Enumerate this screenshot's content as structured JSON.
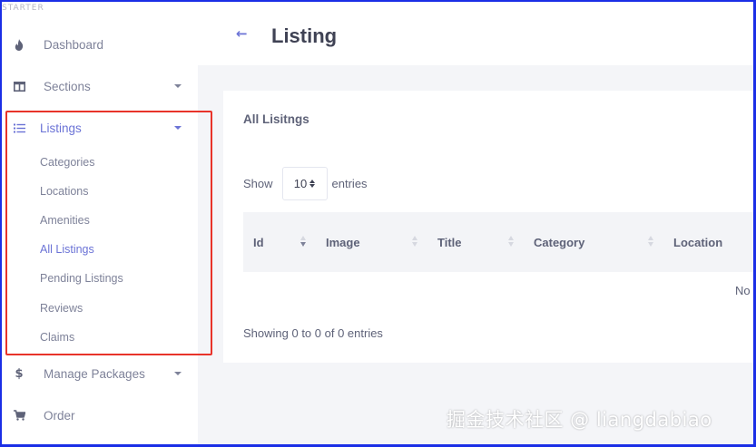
{
  "brand": "STARTER",
  "header": {
    "title": "Listing"
  },
  "sidebar": {
    "items": [
      {
        "label": "Dashboard",
        "icon": "fire-icon"
      },
      {
        "label": "Sections",
        "icon": "columns-icon"
      },
      {
        "label": "Listings",
        "icon": "list-icon"
      },
      {
        "label": "Manage Packages",
        "icon": "dollar-icon"
      },
      {
        "label": "Order",
        "icon": "cart-icon"
      }
    ],
    "submenu": [
      "Categories",
      "Locations",
      "Amenities",
      "All Listings",
      "Pending Listings",
      "Reviews",
      "Claims"
    ]
  },
  "card": {
    "title": "All Lisitngs",
    "show_label": "Show",
    "page_length": "10",
    "entries_label": "entries",
    "columns": [
      "Id",
      "Image",
      "Title",
      "Category",
      "Location"
    ],
    "empty_text": "No",
    "info": "Showing 0 to 0 of 0 entries"
  },
  "watermark": "掘金技术社区 @ liangdabiao",
  "colors": {
    "accent": "#6b73d6",
    "highlight": "#e8332a",
    "frame": "#1a2ee6"
  }
}
